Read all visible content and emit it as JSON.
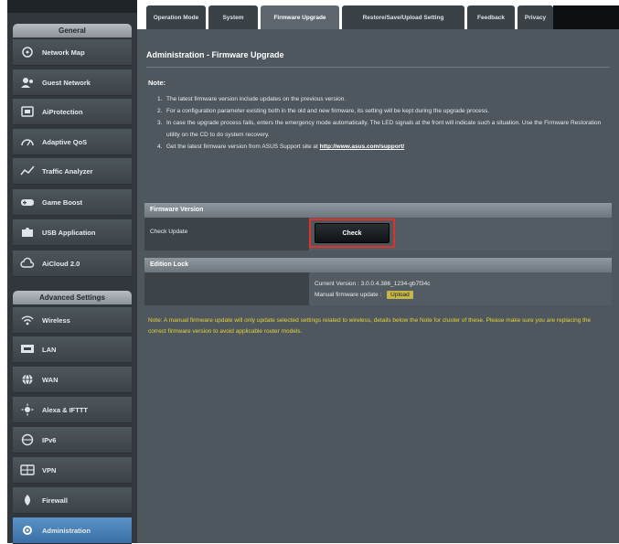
{
  "sidebar": {
    "general_header": "General",
    "advanced_header": "Advanced Settings",
    "items": [
      {
        "label": "Network Map",
        "icon": "network-map-icon"
      },
      {
        "label": "Guest Network",
        "icon": "guest-network-icon"
      },
      {
        "label": "AiProtection",
        "icon": "shield-icon"
      },
      {
        "label": "Adaptive QoS",
        "icon": "gauge-icon"
      },
      {
        "label": "Traffic Analyzer",
        "icon": "traffic-analyzer-icon"
      },
      {
        "label": "Game Boost",
        "icon": "game-boost-icon"
      },
      {
        "label": "USB Application",
        "icon": "puzzle-icon"
      },
      {
        "label": "AiCloud 2.0",
        "icon": "cloud-icon"
      }
    ],
    "advanced_items": [
      {
        "label": "Wireless",
        "icon": "wireless-icon"
      },
      {
        "label": "LAN",
        "icon": "lan-icon"
      },
      {
        "label": "WAN",
        "icon": "globe-icon"
      },
      {
        "label": "Alexa & IFTTT",
        "icon": "alexa-icon"
      },
      {
        "label": "IPv6",
        "icon": "ipv6-icon"
      },
      {
        "label": "VPN",
        "icon": "vpn-icon"
      },
      {
        "label": "Firewall",
        "icon": "firewall-icon"
      },
      {
        "label": "Administration",
        "icon": "admin-icon"
      }
    ]
  },
  "tabs": [
    {
      "label": "Operation Mode"
    },
    {
      "label": "System"
    },
    {
      "label": "Firmware Upgrade"
    },
    {
      "label": "Restore/Save/Upload Setting"
    },
    {
      "label": "Feedback"
    },
    {
      "label": "Privacy"
    }
  ],
  "page": {
    "title": "Administration - Firmware Upgrade",
    "note_label": "Note:",
    "notes": [
      "The latest firmware version include updates on the previous version.",
      "For a configuration parameter existing both in the old and new firmware, its setting will be kept during the upgrade process.",
      "In case the upgrade process fails, enters the emergency mode automatically. The LED signals at the front will indicate such a situation. Use the Firmware Restoration utility on the CD to do system recovery."
    ],
    "note4_text": "Get the latest firmware version from ASUS Support site at",
    "note4_link": "http://www.asus.com/support/",
    "firmware_version_header": "Firmware Version",
    "check_update_label": "Check Update",
    "check_button": "Check",
    "firmware_section_header": "Edition Lock",
    "current_version": "Current Version : 3.0.0.4.386_1234-gb7f34c",
    "manual_label": "Manual firmware update :",
    "upload_button": "Upload",
    "warning": "Note: A manual firmware update will only update selected settings related to wireless, details below the Note for cluster of these. Please make sure you are replacing the correct firmware version to avoid applicable router models."
  },
  "colors": {
    "accent_red": "#e0312b",
    "warning_yellow": "#e8d23b",
    "active_blue": "#3a6fa3"
  }
}
